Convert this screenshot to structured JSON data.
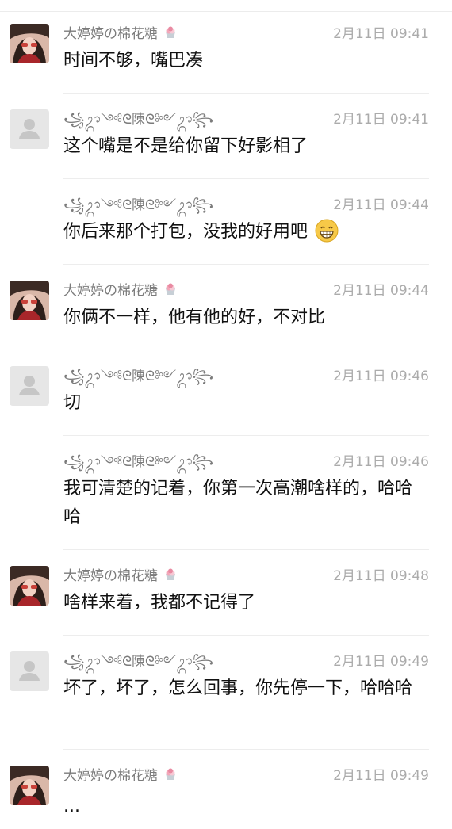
{
  "messages": [
    {
      "user": "dtt",
      "name": "大婷婷の棉花糖",
      "time": "2月11日 09:41",
      "text": "时间不够，嘴巴凑",
      "avatar": "photo"
    },
    {
      "user": "chen",
      "name": "꧁ᬊ༺ᘓ陳ᘓ༻ᬊ꧂",
      "time": "2月11日 09:41",
      "text": "这个嘴是不是给你留下好影相了",
      "avatar": "default"
    },
    {
      "user": "chen",
      "name": "꧁ᬊ༺ᘓ陳ᘓ༻ᬊ꧂",
      "time": "2月11日 09:44",
      "text": "你后来那个打包，没我的好用吧",
      "avatar": "none",
      "emoji": "grin"
    },
    {
      "user": "dtt",
      "name": "大婷婷の棉花糖",
      "time": "2月11日 09:44",
      "text": "你俩不一样，他有他的好，不对比",
      "avatar": "photo"
    },
    {
      "user": "chen",
      "name": "꧁ᬊ༺ᘓ陳ᘓ༻ᬊ꧂",
      "time": "2月11日 09:46",
      "text": "切",
      "avatar": "default"
    },
    {
      "user": "chen",
      "name": "꧁ᬊ༺ᘓ陳ᘓ༻ᬊ꧂",
      "time": "2月11日 09:46",
      "text": "我可清楚的记着，你第一次高潮啥样的，哈哈哈",
      "avatar": "none"
    },
    {
      "user": "dtt",
      "name": "大婷婷の棉花糖",
      "time": "2月11日 09:48",
      "text": "啥样来着，我都不记得了",
      "avatar": "photo"
    },
    {
      "user": "chen",
      "name": "꧁ᬊ༺ᘓ陳ᘓ༻ᬊ꧂",
      "time": "2月11日 09:49",
      "text": "坏了，坏了，怎么回事，你先停一下，哈哈哈",
      "avatar": "default"
    },
    {
      "user": "dtt",
      "name": "大婷婷の棉花糖",
      "time": "2月11日 09:49",
      "text": "...",
      "avatar": "photo"
    }
  ],
  "icons": {
    "name_badge": "ice-cream-cup-icon",
    "grin_emoji": "grinning-face-icon",
    "default_avatar": "person-silhouette-icon"
  },
  "colors": {
    "name": "#7b7b7b",
    "time": "#ababab",
    "text": "#111111",
    "divider": "#ededed"
  }
}
